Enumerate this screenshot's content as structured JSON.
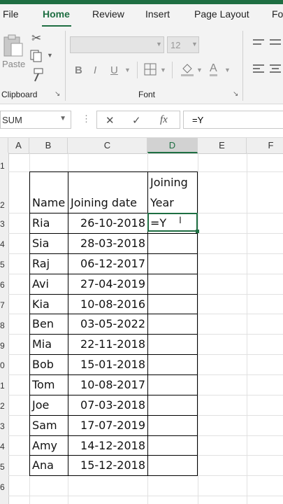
{
  "menu": {
    "tabs": [
      {
        "label": "File",
        "active": false
      },
      {
        "label": "Home",
        "active": true
      },
      {
        "label": "Review",
        "active": false
      },
      {
        "label": "Insert",
        "active": false
      },
      {
        "label": "Page Layout",
        "active": false
      },
      {
        "label": "Fo",
        "active": false
      }
    ]
  },
  "ribbon": {
    "paste_label": "Paste",
    "clipboard_label": "Clipboard",
    "font_group_label": "Font",
    "font_size": "12",
    "bold": "B",
    "italic": "I",
    "underline": "U"
  },
  "formula_bar": {
    "name_box": "SUM",
    "cancel": "✕",
    "enter": "✓",
    "fx": "fx",
    "value": "=Y"
  },
  "sheet": {
    "columns": [
      "A",
      "B",
      "C",
      "D",
      "E",
      "F"
    ],
    "selected_column": "D",
    "rows": [
      "1",
      "2",
      "3",
      "4",
      "5",
      "6",
      "7",
      "8",
      "9",
      "0",
      "1",
      "2",
      "3",
      "4",
      "5",
      "6"
    ],
    "header": {
      "name": "Name",
      "joining_date": "Joining date",
      "joining_year_1": "Joining",
      "joining_year_2": "Year"
    },
    "records": [
      {
        "name": "Ria",
        "date": "26-10-2018",
        "year": "=Y"
      },
      {
        "name": "Sia",
        "date": "28-03-2018",
        "year": ""
      },
      {
        "name": "Raj",
        "date": "06-12-2017",
        "year": ""
      },
      {
        "name": "Avi",
        "date": "27-04-2019",
        "year": ""
      },
      {
        "name": "Kia",
        "date": "10-08-2016",
        "year": ""
      },
      {
        "name": "Ben",
        "date": "03-05-2022",
        "year": ""
      },
      {
        "name": "Mia",
        "date": "22-11-2018",
        "year": ""
      },
      {
        "name": "Bob",
        "date": "15-01-2018",
        "year": ""
      },
      {
        "name": "Tom",
        "date": "10-08-2017",
        "year": ""
      },
      {
        "name": "Joe",
        "date": "07-03-2018",
        "year": ""
      },
      {
        "name": "Sam",
        "date": "17-07-2019",
        "year": ""
      },
      {
        "name": "Amy",
        "date": "14-12-2018",
        "year": ""
      },
      {
        "name": "Ana",
        "date": "15-12-2018",
        "year": ""
      }
    ]
  },
  "colors": {
    "accent": "#1e6e42"
  }
}
